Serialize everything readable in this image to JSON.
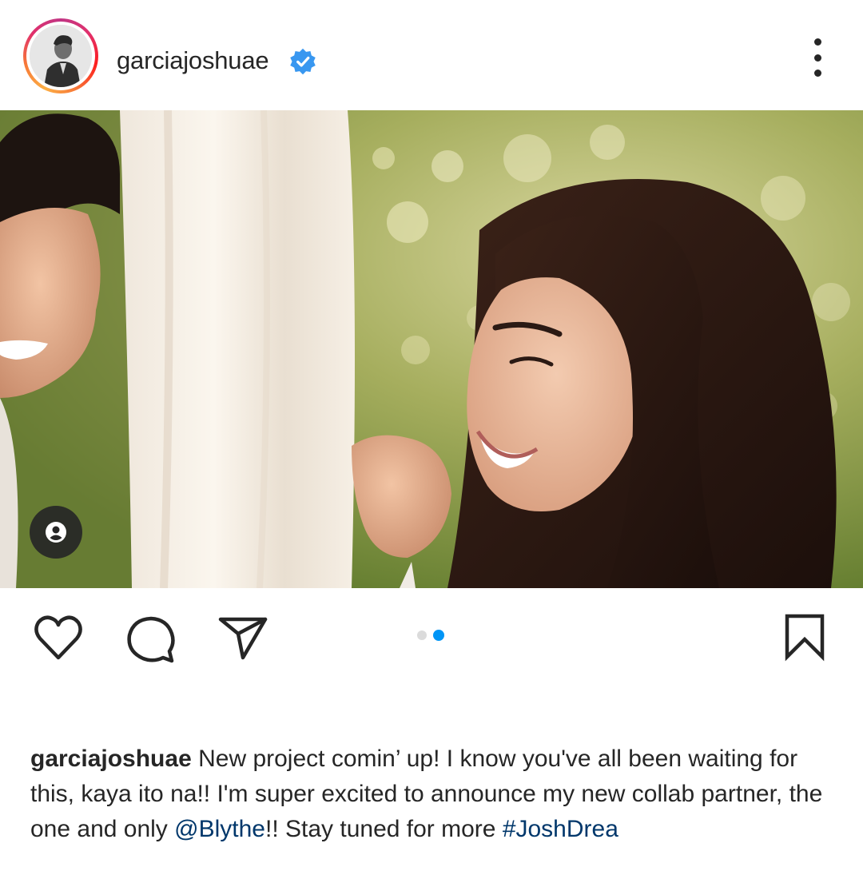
{
  "post": {
    "username": "garciajoshuae",
    "verified": true,
    "avatar_icon": "profile-photo",
    "more_icon": "more-vertical-icon"
  },
  "media": {
    "image_description_icon": "photo",
    "tagged_people_icon": "user-tag-icon",
    "carousel": {
      "count": 2,
      "active_index": 1
    }
  },
  "actions": {
    "like_icon": "heart-icon",
    "comment_icon": "comment-icon",
    "share_icon": "send-icon",
    "save_icon": "bookmark-icon"
  },
  "caption": {
    "username": "garciajoshuae",
    "text_part1": " New project comin’ up! I know you've all been waiting for this, kaya ito na!! I'm super excited to announce my new collab partner, the one and only ",
    "mention": "@Blythe",
    "text_part2": "!! Stay tuned for more ",
    "hashtag": "#JoshDrea"
  },
  "colors": {
    "link": "#00376b",
    "active_dot": "#0095f6",
    "verified_badge": "#3897f0"
  }
}
